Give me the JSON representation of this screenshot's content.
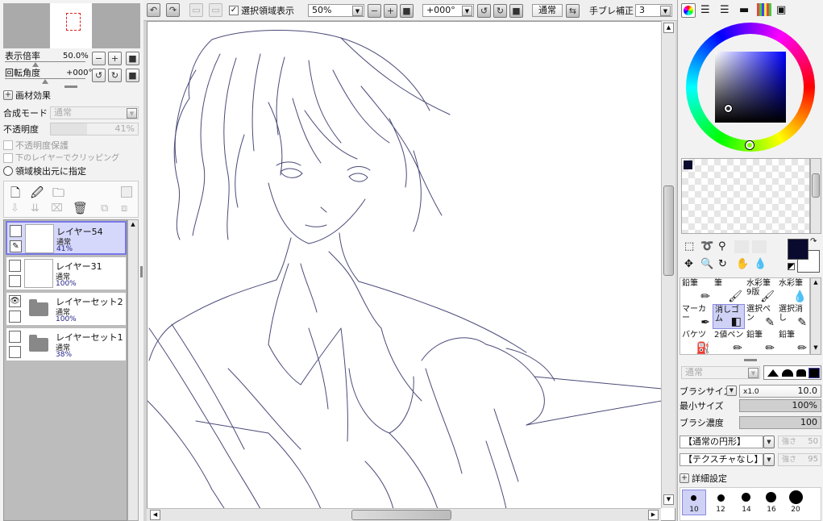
{
  "left": {
    "zoom_label": "表示倍率",
    "zoom_value": "50.0%",
    "rotation_label": "回転角度",
    "rotation_value": "+000°",
    "material_effect": "画材効果",
    "blend_mode_label": "合成モード",
    "blend_mode_value": "通常",
    "opacity_label": "不透明度",
    "opacity_value": "41%",
    "preserve_opacity": "不透明度保護",
    "clip_to_lower": "下のレイヤーでクリッピング",
    "region_source": "領域検出元に指定",
    "layers": [
      {
        "name": "レイヤー54",
        "mode": "通常",
        "opacity": "41%"
      },
      {
        "name": "レイヤー31",
        "mode": "通常",
        "opacity": "100%"
      },
      {
        "name": "レイヤーセット2",
        "mode": "通常",
        "opacity": "100%"
      },
      {
        "name": "レイヤーセット1",
        "mode": "通常",
        "opacity": "38%"
      }
    ]
  },
  "toolbar": {
    "show_selection": "選択領域表示",
    "zoom": "50%",
    "rotation": "+000°",
    "mode": "通常",
    "stabilizer_label": "手ブレ補正",
    "stabilizer_value": "3"
  },
  "right": {
    "tools": [
      {
        "label": "鉛筆",
        "icon": "✏"
      },
      {
        "label": "筆",
        "icon": "🖌"
      },
      {
        "label": "水彩筆\n9版",
        "icon": "🖌"
      },
      {
        "label": "水彩筆",
        "icon": "💧"
      },
      {
        "label": "マーカー",
        "icon": "✒"
      },
      {
        "label": "消しゴム",
        "icon": "◧"
      },
      {
        "label": "選択ペン",
        "icon": "✎"
      },
      {
        "label": "選択消し",
        "icon": "✎"
      },
      {
        "label": "バケツ",
        "icon": "⛽"
      },
      {
        "label": "2値ペン",
        "icon": "✏"
      },
      {
        "label": "鉛筆",
        "icon": "✏"
      },
      {
        "label": "鉛筆",
        "icon": "✏"
      }
    ],
    "brush_mode": "通常",
    "brush_size_label": "ブラシサイズ",
    "brush_size_mult": "x1.0",
    "brush_size_value": "10.0",
    "min_size_label": "最小サイズ",
    "min_size_value": "100%",
    "density_label": "ブラシ濃度",
    "density_value": "100",
    "shape": "【通常の円形】",
    "shape_strength_label": "強さ",
    "shape_strength_value": "50",
    "texture": "【テクスチャなし】",
    "texture_strength_label": "強さ",
    "texture_strength_value": "95",
    "advanced": "詳細設定",
    "brush_sizes": [
      "10",
      "12",
      "14",
      "16",
      "20"
    ]
  },
  "colors": {
    "primary": "#0a0a2e",
    "secondary": "#ffffff",
    "selection": "#7878e8",
    "line_art": "#4a4a78"
  }
}
